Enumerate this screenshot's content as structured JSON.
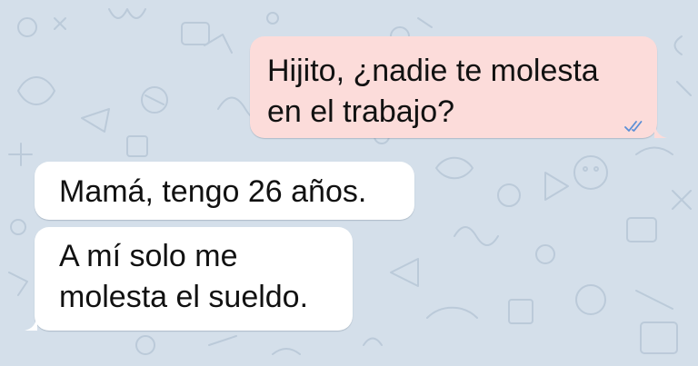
{
  "colors": {
    "wallpaper": "#d4dfea",
    "outgoing_bubble": "#fcdcda",
    "incoming_bubble": "#ffffff",
    "read_ticks": "#5b8fd6"
  },
  "messages": [
    {
      "direction": "outgoing",
      "lines": [
        "Hijito, ¿nadie te molesta",
        "en el trabajo?"
      ],
      "status_icon": "double-check-read-icon"
    },
    {
      "direction": "incoming",
      "lines": [
        "Mamá, tengo 26 años."
      ]
    },
    {
      "direction": "incoming",
      "lines": [
        "A mí solo me",
        "molesta el sueldo."
      ]
    }
  ]
}
